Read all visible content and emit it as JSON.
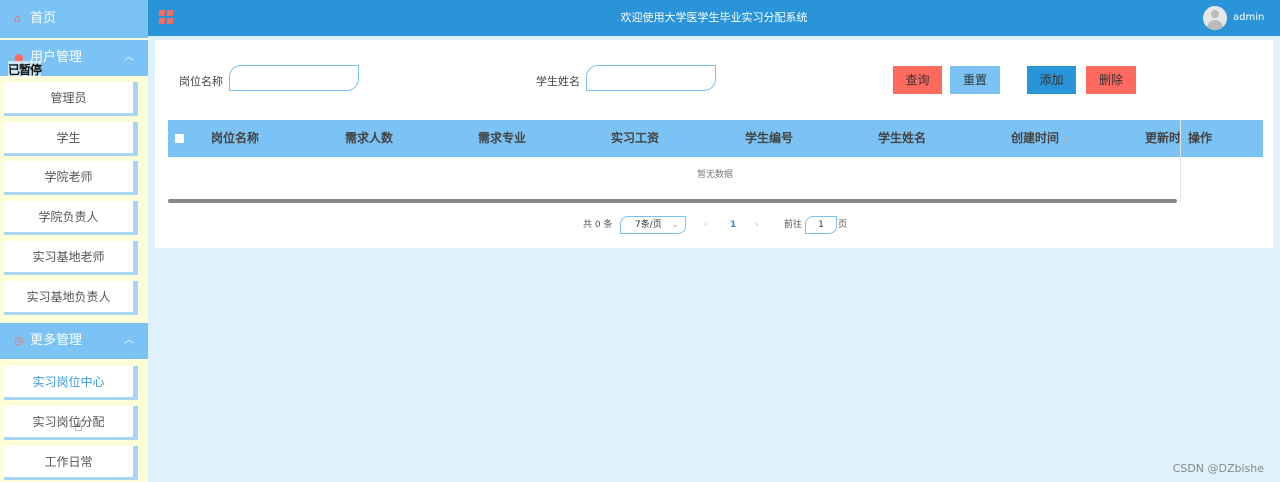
{
  "sidebar": {
    "home_label": "首页",
    "group_user_label": "用户管理",
    "overlay_text": "已暂停",
    "user_items": [
      "管理员",
      "学生",
      "学院老师",
      "学院负责人",
      "实习基地老师",
      "实习基地负责人"
    ],
    "group_more_label": "更多管理",
    "more_items": [
      "实习岗位中心",
      "实习岗位分配",
      "工作日常"
    ]
  },
  "header": {
    "title": "欢迎使用大学医学生毕业实习分配系统",
    "username": "admin"
  },
  "search": {
    "position_label": "岗位名称",
    "student_label": "学生姓名",
    "query_btn": "查询",
    "reset_btn": "重置",
    "add_btn": "添加",
    "delete_btn": "删除"
  },
  "table": {
    "columns": [
      "岗位名称",
      "需求人数",
      "需求专业",
      "实习工资",
      "学生编号",
      "学生姓名",
      "创建时间",
      "更新时"
    ],
    "sort_mark": "↕",
    "op_column": "操作",
    "empty_text": "暂无数据"
  },
  "pagination": {
    "total": "共 0 条",
    "page_size": "7条/页",
    "prev": "‹",
    "current_page": "1",
    "next": "›",
    "goto_prefix": "前往",
    "goto_value": "1",
    "goto_suffix": "页"
  },
  "watermark": "CSDN @DZbishe",
  "colors": {
    "sidebar_bg": "#fdfdd8",
    "menu_blue": "#7cc3f5",
    "header_blue": "#2a94d8",
    "accent_red": "#ff6a5f",
    "page_bg": "#dff1fc"
  }
}
